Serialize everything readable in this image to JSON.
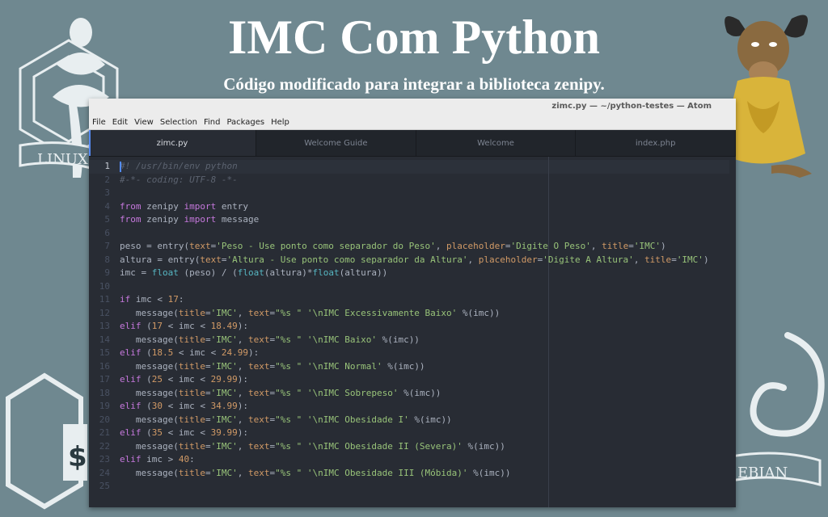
{
  "page": {
    "headline": "IMC Com Python",
    "subheadline": "Código modificado para integrar a biblioteca zenipy."
  },
  "window": {
    "title": "zimc.py — ~/python-testes — Atom",
    "menu": [
      "File",
      "Edit",
      "View",
      "Selection",
      "Find",
      "Packages",
      "Help"
    ],
    "tabs": [
      "zimc.py",
      "Welcome Guide",
      "Welcome",
      "index.php"
    ],
    "active_tab": 0
  },
  "decorations": {
    "linux_banner": "LINUX",
    "debian_banner": "EBIAN",
    "dollar_sign": "$"
  },
  "editor": {
    "line_numbers": [
      "1",
      "2",
      "3",
      "4",
      "5",
      "6",
      "7",
      "8",
      "9",
      "10",
      "11",
      "12",
      "13",
      "14",
      "15",
      "16",
      "17",
      "18",
      "19",
      "20",
      "21",
      "22",
      "23",
      "24",
      "25"
    ],
    "lines": [
      [
        [
          "c",
          "#! /usr/bin/env python"
        ]
      ],
      [
        [
          "c",
          "#-*- coding: UTF-8 -*-"
        ]
      ],
      [],
      [
        [
          "k",
          "from"
        ],
        [
          "o",
          " zenipy "
        ],
        [
          "k",
          "import"
        ],
        [
          "o",
          " entry"
        ]
      ],
      [
        [
          "k",
          "from"
        ],
        [
          "o",
          " zenipy "
        ],
        [
          "k",
          "import"
        ],
        [
          "o",
          " message"
        ]
      ],
      [],
      [
        [
          "o",
          "peso = entry("
        ],
        [
          "a",
          "text"
        ],
        [
          "o",
          "="
        ],
        [
          "s",
          "'Peso - Use ponto como separador do Peso'"
        ],
        [
          "o",
          ", "
        ],
        [
          "a",
          "placeholder"
        ],
        [
          "o",
          "="
        ],
        [
          "s",
          "'Digite O Peso'"
        ],
        [
          "o",
          ", "
        ],
        [
          "a",
          "title"
        ],
        [
          "o",
          "="
        ],
        [
          "s",
          "'IMC'"
        ],
        [
          "o",
          ")"
        ]
      ],
      [
        [
          "o",
          "altura = entry("
        ],
        [
          "a",
          "text"
        ],
        [
          "o",
          "="
        ],
        [
          "s",
          "'Altura - Use ponto como separador da Altura'"
        ],
        [
          "o",
          ", "
        ],
        [
          "a",
          "placeholder"
        ],
        [
          "o",
          "="
        ],
        [
          "s",
          "'Digite A Altura'"
        ],
        [
          "o",
          ", "
        ],
        [
          "a",
          "title"
        ],
        [
          "o",
          "="
        ],
        [
          "s",
          "'IMC'"
        ],
        [
          "o",
          ")"
        ]
      ],
      [
        [
          "o",
          "imc = "
        ],
        [
          "f",
          "float"
        ],
        [
          "o",
          " (peso) / ("
        ],
        [
          "f",
          "float"
        ],
        [
          "o",
          "(altura)*"
        ],
        [
          "f",
          "float"
        ],
        [
          "o",
          "(altura))"
        ]
      ],
      [],
      [
        [
          "k",
          "if"
        ],
        [
          "o",
          " imc < "
        ],
        [
          "a",
          "17"
        ],
        [
          "o",
          ":"
        ]
      ],
      [
        [
          "o",
          "   message("
        ],
        [
          "a",
          "title"
        ],
        [
          "o",
          "="
        ],
        [
          "s",
          "'IMC'"
        ],
        [
          "o",
          ", "
        ],
        [
          "a",
          "text"
        ],
        [
          "o",
          "="
        ],
        [
          "s",
          "\"%s \""
        ],
        [
          "o",
          " "
        ],
        [
          "s",
          "'\\nIMC Excessivamente Baixo'"
        ],
        [
          "o",
          " %(imc))"
        ]
      ],
      [
        [
          "k",
          "elif"
        ],
        [
          "o",
          " ("
        ],
        [
          "a",
          "17"
        ],
        [
          "o",
          " < imc < "
        ],
        [
          "a",
          "18.49"
        ],
        [
          "o",
          "):"
        ]
      ],
      [
        [
          "o",
          "   message("
        ],
        [
          "a",
          "title"
        ],
        [
          "o",
          "="
        ],
        [
          "s",
          "'IMC'"
        ],
        [
          "o",
          ", "
        ],
        [
          "a",
          "text"
        ],
        [
          "o",
          "="
        ],
        [
          "s",
          "\"%s \""
        ],
        [
          "o",
          " "
        ],
        [
          "s",
          "'\\nIMC Baixo'"
        ],
        [
          "o",
          " %(imc))"
        ]
      ],
      [
        [
          "k",
          "elif"
        ],
        [
          "o",
          " ("
        ],
        [
          "a",
          "18.5"
        ],
        [
          "o",
          " < imc < "
        ],
        [
          "a",
          "24.99"
        ],
        [
          "o",
          "):"
        ]
      ],
      [
        [
          "o",
          "   message("
        ],
        [
          "a",
          "title"
        ],
        [
          "o",
          "="
        ],
        [
          "s",
          "'IMC'"
        ],
        [
          "o",
          ", "
        ],
        [
          "a",
          "text"
        ],
        [
          "o",
          "="
        ],
        [
          "s",
          "\"%s \""
        ],
        [
          "o",
          " "
        ],
        [
          "s",
          "'\\nIMC Normal'"
        ],
        [
          "o",
          " %(imc))"
        ]
      ],
      [
        [
          "k",
          "elif"
        ],
        [
          "o",
          " ("
        ],
        [
          "a",
          "25"
        ],
        [
          "o",
          " < imc < "
        ],
        [
          "a",
          "29.99"
        ],
        [
          "o",
          "):"
        ]
      ],
      [
        [
          "o",
          "   message("
        ],
        [
          "a",
          "title"
        ],
        [
          "o",
          "="
        ],
        [
          "s",
          "'IMC'"
        ],
        [
          "o",
          ", "
        ],
        [
          "a",
          "text"
        ],
        [
          "o",
          "="
        ],
        [
          "s",
          "\"%s \""
        ],
        [
          "o",
          " "
        ],
        [
          "s",
          "'\\nIMC Sobrepeso'"
        ],
        [
          "o",
          " %(imc))"
        ]
      ],
      [
        [
          "k",
          "elif"
        ],
        [
          "o",
          " ("
        ],
        [
          "a",
          "30"
        ],
        [
          "o",
          " < imc < "
        ],
        [
          "a",
          "34.99"
        ],
        [
          "o",
          "):"
        ]
      ],
      [
        [
          "o",
          "   message("
        ],
        [
          "a",
          "title"
        ],
        [
          "o",
          "="
        ],
        [
          "s",
          "'IMC'"
        ],
        [
          "o",
          ", "
        ],
        [
          "a",
          "text"
        ],
        [
          "o",
          "="
        ],
        [
          "s",
          "\"%s \""
        ],
        [
          "o",
          " "
        ],
        [
          "s",
          "'\\nIMC Obesidade I'"
        ],
        [
          "o",
          " %(imc))"
        ]
      ],
      [
        [
          "k",
          "elif"
        ],
        [
          "o",
          " ("
        ],
        [
          "a",
          "35"
        ],
        [
          "o",
          " < imc < "
        ],
        [
          "a",
          "39.99"
        ],
        [
          "o",
          "):"
        ]
      ],
      [
        [
          "o",
          "   message("
        ],
        [
          "a",
          "title"
        ],
        [
          "o",
          "="
        ],
        [
          "s",
          "'IMC'"
        ],
        [
          "o",
          ", "
        ],
        [
          "a",
          "text"
        ],
        [
          "o",
          "="
        ],
        [
          "s",
          "\"%s \""
        ],
        [
          "o",
          " "
        ],
        [
          "s",
          "'\\nIMC Obesidade II (Severa)'"
        ],
        [
          "o",
          " %(imc))"
        ]
      ],
      [
        [
          "k",
          "elif"
        ],
        [
          "o",
          " imc > "
        ],
        [
          "a",
          "40"
        ],
        [
          "o",
          ":"
        ]
      ],
      [
        [
          "o",
          "   message("
        ],
        [
          "a",
          "title"
        ],
        [
          "o",
          "="
        ],
        [
          "s",
          "'IMC'"
        ],
        [
          "o",
          ", "
        ],
        [
          "a",
          "text"
        ],
        [
          "o",
          "="
        ],
        [
          "s",
          "\"%s \""
        ],
        [
          "o",
          " "
        ],
        [
          "s",
          "'\\nIMC Obesidade III (Móbida)'"
        ],
        [
          "o",
          " %(imc))"
        ]
      ],
      []
    ]
  }
}
